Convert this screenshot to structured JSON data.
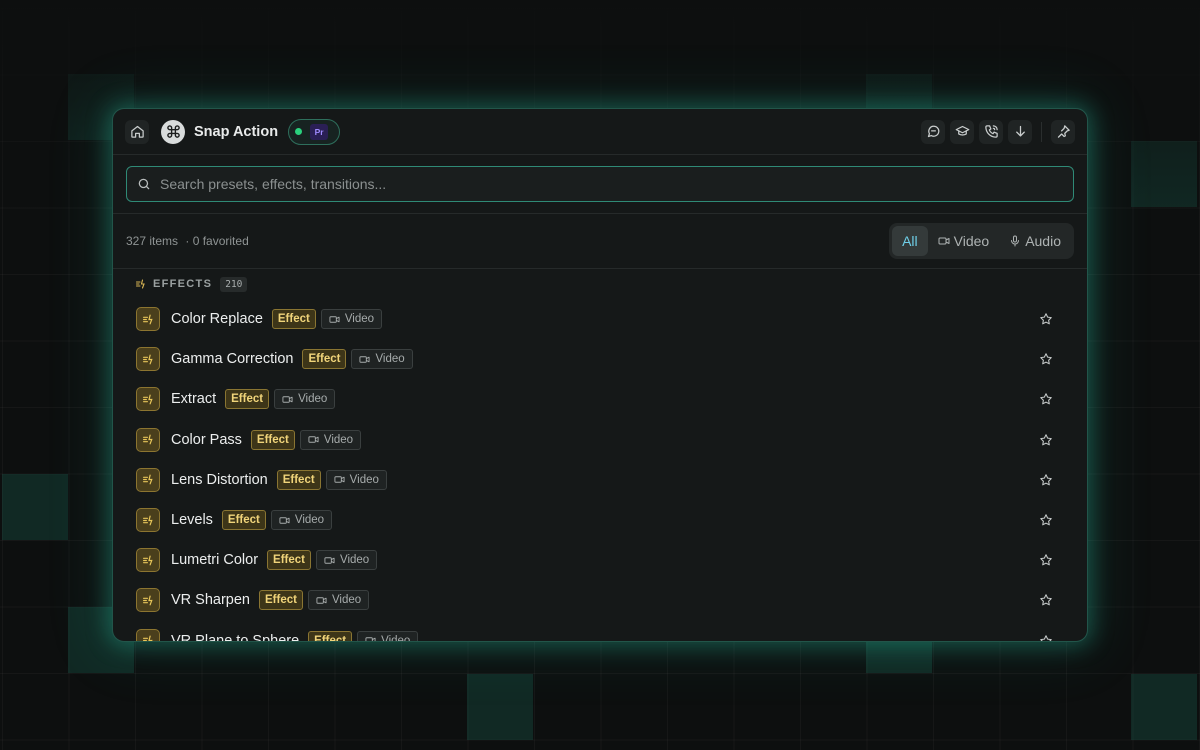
{
  "app": {
    "title": "Snap Action",
    "host_app_badge": "Pr",
    "connected_color": "#2ad17d",
    "accent_color": "#2f8a76"
  },
  "toolbar_icons": [
    "home-icon",
    "command-logo-icon",
    "chat-icon",
    "graduation-cap-icon",
    "phone-icon",
    "download-icon",
    "pin-icon"
  ],
  "search": {
    "placeholder": "Search presets, effects, transitions...",
    "value": ""
  },
  "summary": {
    "items": "327 items",
    "favorited": "· 0 favorited"
  },
  "filters": [
    {
      "label": "All",
      "active": true
    },
    {
      "label": "Video",
      "active": false,
      "icon": "video-icon"
    },
    {
      "label": "Audio",
      "active": false,
      "icon": "mic-icon"
    }
  ],
  "section": {
    "title": "EFFECTS",
    "count": "210"
  },
  "items": [
    {
      "name": "Color Replace",
      "type": "Effect",
      "media": "Video"
    },
    {
      "name": "Gamma Correction",
      "type": "Effect",
      "media": "Video"
    },
    {
      "name": "Extract",
      "type": "Effect",
      "media": "Video"
    },
    {
      "name": "Color Pass",
      "type": "Effect",
      "media": "Video"
    },
    {
      "name": "Lens Distortion",
      "type": "Effect",
      "media": "Video"
    },
    {
      "name": "Levels",
      "type": "Effect",
      "media": "Video"
    },
    {
      "name": "Lumetri Color",
      "type": "Effect",
      "media": "Video"
    },
    {
      "name": "VR Sharpen",
      "type": "Effect",
      "media": "Video"
    },
    {
      "name": "VR Plane to Sphere",
      "type": "Effect",
      "media": "Video"
    }
  ]
}
